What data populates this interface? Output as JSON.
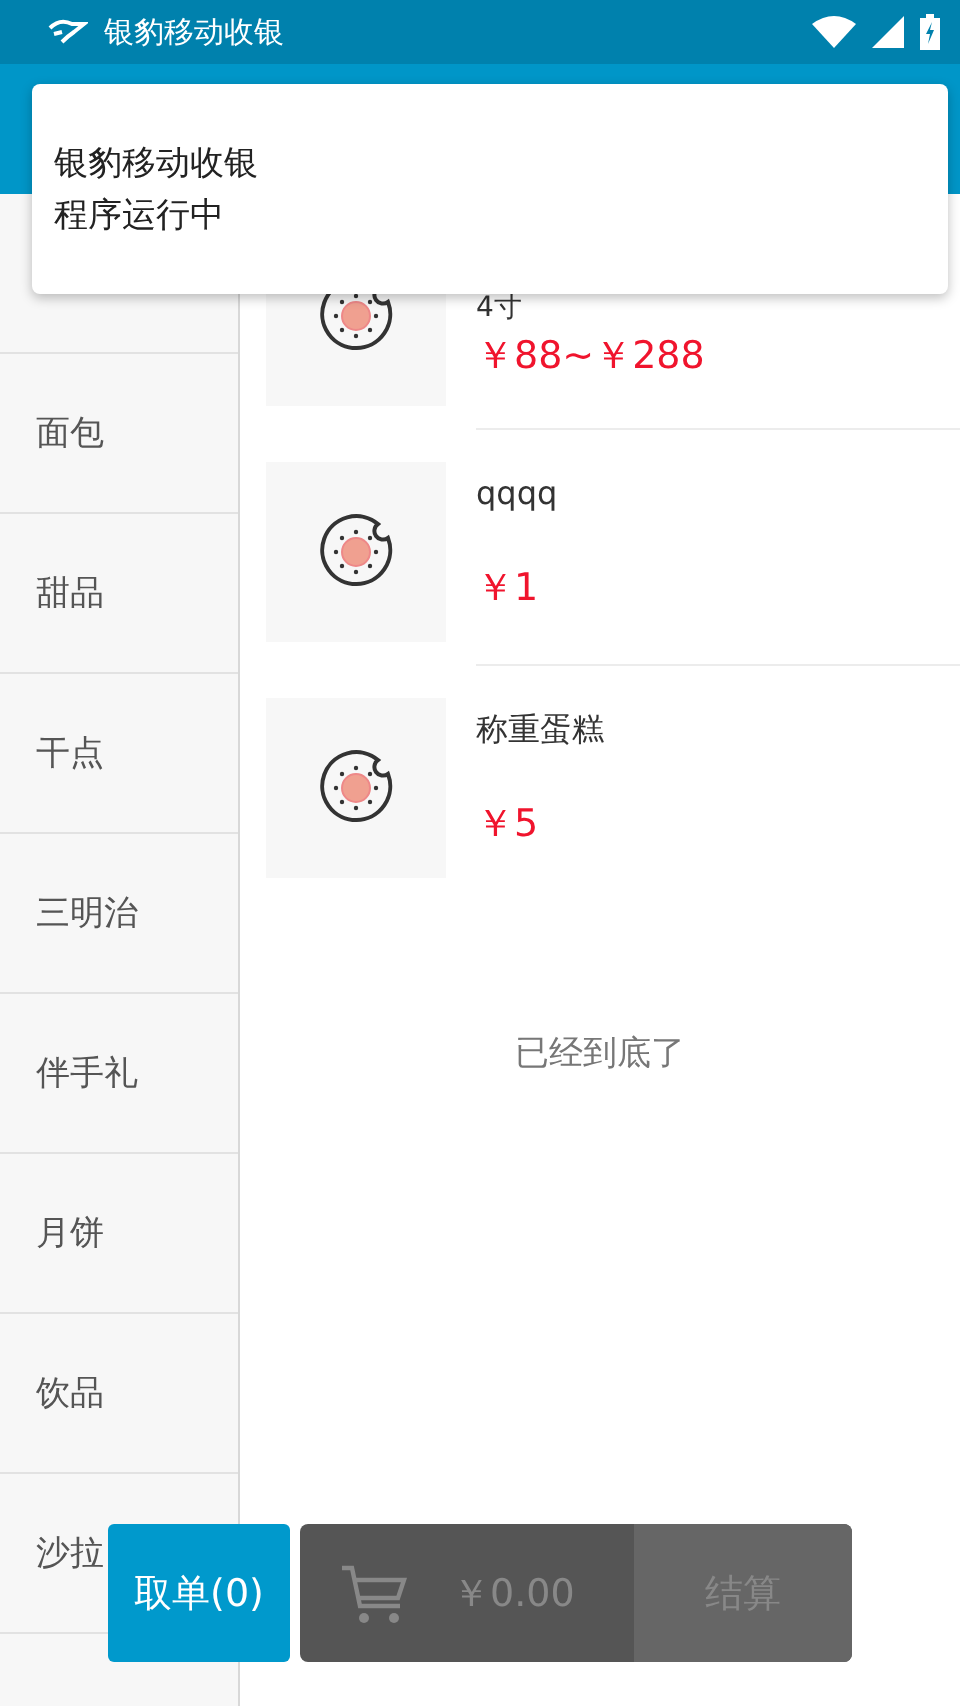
{
  "status_bar": {
    "app_name": "银豹移动收银"
  },
  "notification": {
    "title": "银豹移动收银",
    "text": "程序运行中"
  },
  "categories": [
    {
      "label": "面包"
    },
    {
      "label": "甜品"
    },
    {
      "label": "干点"
    },
    {
      "label": "三明治"
    },
    {
      "label": "伴手礼"
    },
    {
      "label": "月饼"
    },
    {
      "label": "饮品"
    },
    {
      "label": "沙拉"
    }
  ],
  "products": [
    {
      "spec": "4寸",
      "price": "￥88~￥288"
    },
    {
      "name": "qqqq",
      "price": "￥1"
    },
    {
      "name": "称重蛋糕",
      "price": "￥5"
    }
  ],
  "list_end": "已经到底了",
  "bottom_bar": {
    "pending_button": "取单(0)",
    "total": "￥0.00",
    "checkout_button": "结算"
  }
}
